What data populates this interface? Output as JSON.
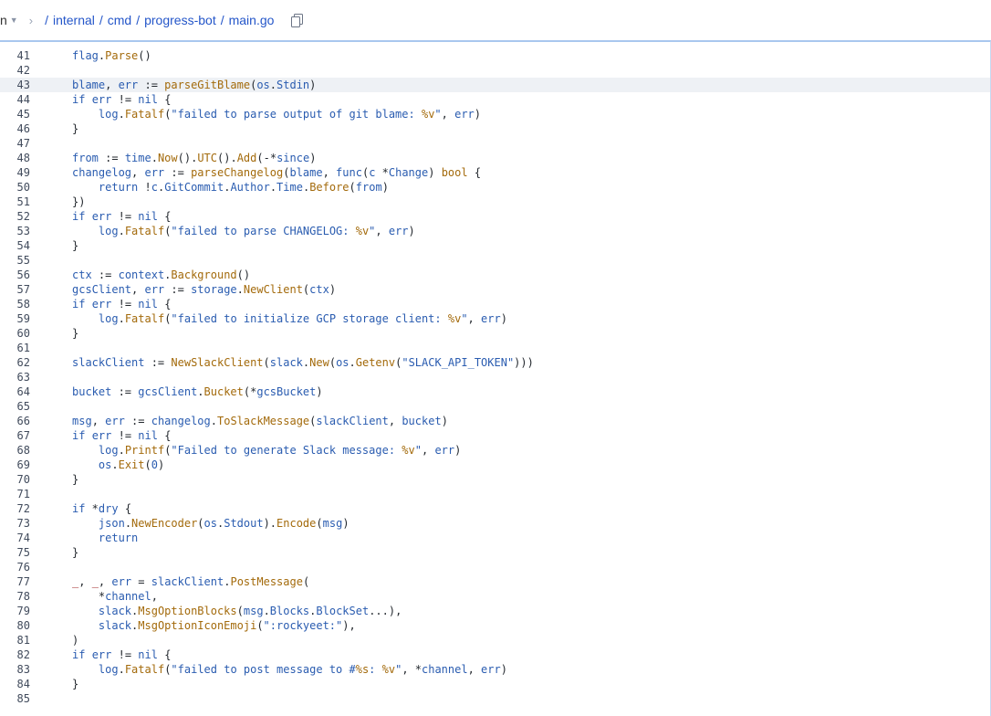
{
  "breadcrumb": {
    "branch": "n",
    "segments": [
      "internal",
      "cmd",
      "progress-bot",
      "main.go"
    ]
  },
  "editor": {
    "highlighted_line": 43,
    "lines": [
      {
        "n": 41,
        "indent": 1,
        "tokens": [
          [
            "ident",
            "flag"
          ],
          [
            "op",
            "."
          ],
          [
            "fn",
            "Parse"
          ],
          [
            "op",
            "()"
          ]
        ]
      },
      {
        "n": 42,
        "indent": 0,
        "tokens": []
      },
      {
        "n": 43,
        "indent": 1,
        "tokens": [
          [
            "ident",
            "blame"
          ],
          [
            "op",
            ", "
          ],
          [
            "ident",
            "err"
          ],
          [
            "op",
            " := "
          ],
          [
            "fn",
            "parseGitBlame"
          ],
          [
            "op",
            "("
          ],
          [
            "ident",
            "os"
          ],
          [
            "op",
            "."
          ],
          [
            "ident",
            "Stdin"
          ],
          [
            "op",
            ")"
          ]
        ]
      },
      {
        "n": 44,
        "indent": 1,
        "tokens": [
          [
            "kw",
            "if"
          ],
          [
            "op",
            " "
          ],
          [
            "ident",
            "err"
          ],
          [
            "op",
            " != "
          ],
          [
            "kw",
            "nil"
          ],
          [
            "op",
            " {"
          ]
        ]
      },
      {
        "n": 45,
        "indent": 2,
        "tokens": [
          [
            "ident",
            "log"
          ],
          [
            "op",
            "."
          ],
          [
            "fn",
            "Fatalf"
          ],
          [
            "op",
            "("
          ],
          [
            "str",
            "\"failed to parse output of git blame: "
          ],
          [
            "fmt",
            "%v"
          ],
          [
            "str",
            "\""
          ],
          [
            "op",
            ", "
          ],
          [
            "ident",
            "err"
          ],
          [
            "op",
            ")"
          ]
        ]
      },
      {
        "n": 46,
        "indent": 1,
        "tokens": [
          [
            "op",
            "}"
          ]
        ]
      },
      {
        "n": 47,
        "indent": 0,
        "tokens": []
      },
      {
        "n": 48,
        "indent": 1,
        "tokens": [
          [
            "ident",
            "from"
          ],
          [
            "op",
            " := "
          ],
          [
            "ident",
            "time"
          ],
          [
            "op",
            "."
          ],
          [
            "fn",
            "Now"
          ],
          [
            "op",
            "()."
          ],
          [
            "fn",
            "UTC"
          ],
          [
            "op",
            "()."
          ],
          [
            "fn",
            "Add"
          ],
          [
            "op",
            "(-*"
          ],
          [
            "ident",
            "since"
          ],
          [
            "op",
            ")"
          ]
        ]
      },
      {
        "n": 49,
        "indent": 1,
        "tokens": [
          [
            "ident",
            "changelog"
          ],
          [
            "op",
            ", "
          ],
          [
            "ident",
            "err"
          ],
          [
            "op",
            " := "
          ],
          [
            "fn",
            "parseChangelog"
          ],
          [
            "op",
            "("
          ],
          [
            "ident",
            "blame"
          ],
          [
            "op",
            ", "
          ],
          [
            "kw",
            "func"
          ],
          [
            "op",
            "("
          ],
          [
            "ident",
            "c"
          ],
          [
            "op",
            " *"
          ],
          [
            "ident",
            "Change"
          ],
          [
            "op",
            ") "
          ],
          [
            "fn",
            "bool"
          ],
          [
            "op",
            " {"
          ]
        ]
      },
      {
        "n": 50,
        "indent": 2,
        "tokens": [
          [
            "kw",
            "return"
          ],
          [
            "op",
            " !"
          ],
          [
            "ident",
            "c"
          ],
          [
            "op",
            "."
          ],
          [
            "ident",
            "GitCommit"
          ],
          [
            "op",
            "."
          ],
          [
            "ident",
            "Author"
          ],
          [
            "op",
            "."
          ],
          [
            "ident",
            "Time"
          ],
          [
            "op",
            "."
          ],
          [
            "fn",
            "Before"
          ],
          [
            "op",
            "("
          ],
          [
            "ident",
            "from"
          ],
          [
            "op",
            ")"
          ]
        ]
      },
      {
        "n": 51,
        "indent": 1,
        "tokens": [
          [
            "op",
            "})"
          ]
        ]
      },
      {
        "n": 52,
        "indent": 1,
        "tokens": [
          [
            "kw",
            "if"
          ],
          [
            "op",
            " "
          ],
          [
            "ident",
            "err"
          ],
          [
            "op",
            " != "
          ],
          [
            "kw",
            "nil"
          ],
          [
            "op",
            " {"
          ]
        ]
      },
      {
        "n": 53,
        "indent": 2,
        "tokens": [
          [
            "ident",
            "log"
          ],
          [
            "op",
            "."
          ],
          [
            "fn",
            "Fatalf"
          ],
          [
            "op",
            "("
          ],
          [
            "str",
            "\"failed to parse CHANGELOG: "
          ],
          [
            "fmt",
            "%v"
          ],
          [
            "str",
            "\""
          ],
          [
            "op",
            ", "
          ],
          [
            "ident",
            "err"
          ],
          [
            "op",
            ")"
          ]
        ]
      },
      {
        "n": 54,
        "indent": 1,
        "tokens": [
          [
            "op",
            "}"
          ]
        ]
      },
      {
        "n": 55,
        "indent": 0,
        "tokens": []
      },
      {
        "n": 56,
        "indent": 1,
        "tokens": [
          [
            "ident",
            "ctx"
          ],
          [
            "op",
            " := "
          ],
          [
            "ident",
            "context"
          ],
          [
            "op",
            "."
          ],
          [
            "fn",
            "Background"
          ],
          [
            "op",
            "()"
          ]
        ]
      },
      {
        "n": 57,
        "indent": 1,
        "tokens": [
          [
            "ident",
            "gcsClient"
          ],
          [
            "op",
            ", "
          ],
          [
            "ident",
            "err"
          ],
          [
            "op",
            " := "
          ],
          [
            "ident",
            "storage"
          ],
          [
            "op",
            "."
          ],
          [
            "fn",
            "NewClient"
          ],
          [
            "op",
            "("
          ],
          [
            "ident",
            "ctx"
          ],
          [
            "op",
            ")"
          ]
        ]
      },
      {
        "n": 58,
        "indent": 1,
        "tokens": [
          [
            "kw",
            "if"
          ],
          [
            "op",
            " "
          ],
          [
            "ident",
            "err"
          ],
          [
            "op",
            " != "
          ],
          [
            "kw",
            "nil"
          ],
          [
            "op",
            " {"
          ]
        ]
      },
      {
        "n": 59,
        "indent": 2,
        "tokens": [
          [
            "ident",
            "log"
          ],
          [
            "op",
            "."
          ],
          [
            "fn",
            "Fatalf"
          ],
          [
            "op",
            "("
          ],
          [
            "str",
            "\"failed to initialize GCP storage client: "
          ],
          [
            "fmt",
            "%v"
          ],
          [
            "str",
            "\""
          ],
          [
            "op",
            ", "
          ],
          [
            "ident",
            "err"
          ],
          [
            "op",
            ")"
          ]
        ]
      },
      {
        "n": 60,
        "indent": 1,
        "tokens": [
          [
            "op",
            "}"
          ]
        ]
      },
      {
        "n": 61,
        "indent": 0,
        "tokens": []
      },
      {
        "n": 62,
        "indent": 1,
        "tokens": [
          [
            "ident",
            "slackClient"
          ],
          [
            "op",
            " := "
          ],
          [
            "fn",
            "NewSlackClient"
          ],
          [
            "op",
            "("
          ],
          [
            "ident",
            "slack"
          ],
          [
            "op",
            "."
          ],
          [
            "fn",
            "New"
          ],
          [
            "op",
            "("
          ],
          [
            "ident",
            "os"
          ],
          [
            "op",
            "."
          ],
          [
            "fn",
            "Getenv"
          ],
          [
            "op",
            "("
          ],
          [
            "str",
            "\"SLACK_API_TOKEN\""
          ],
          [
            "op",
            "))"
          ],
          [
            "op",
            ")"
          ]
        ]
      },
      {
        "n": 63,
        "indent": 0,
        "tokens": []
      },
      {
        "n": 64,
        "indent": 1,
        "tokens": [
          [
            "ident",
            "bucket"
          ],
          [
            "op",
            " := "
          ],
          [
            "ident",
            "gcsClient"
          ],
          [
            "op",
            "."
          ],
          [
            "fn",
            "Bucket"
          ],
          [
            "op",
            "(*"
          ],
          [
            "ident",
            "gcsBucket"
          ],
          [
            "op",
            ")"
          ]
        ]
      },
      {
        "n": 65,
        "indent": 0,
        "tokens": []
      },
      {
        "n": 66,
        "indent": 1,
        "tokens": [
          [
            "ident",
            "msg"
          ],
          [
            "op",
            ", "
          ],
          [
            "ident",
            "err"
          ],
          [
            "op",
            " := "
          ],
          [
            "ident",
            "changelog"
          ],
          [
            "op",
            "."
          ],
          [
            "fn",
            "ToSlackMessage"
          ],
          [
            "op",
            "("
          ],
          [
            "ident",
            "slackClient"
          ],
          [
            "op",
            ", "
          ],
          [
            "ident",
            "bucket"
          ],
          [
            "op",
            ")"
          ]
        ]
      },
      {
        "n": 67,
        "indent": 1,
        "tokens": [
          [
            "kw",
            "if"
          ],
          [
            "op",
            " "
          ],
          [
            "ident",
            "err"
          ],
          [
            "op",
            " != "
          ],
          [
            "kw",
            "nil"
          ],
          [
            "op",
            " {"
          ]
        ]
      },
      {
        "n": 68,
        "indent": 2,
        "tokens": [
          [
            "ident",
            "log"
          ],
          [
            "op",
            "."
          ],
          [
            "fn",
            "Printf"
          ],
          [
            "op",
            "("
          ],
          [
            "str",
            "\"Failed to generate Slack message: "
          ],
          [
            "fmt",
            "%v"
          ],
          [
            "str",
            "\""
          ],
          [
            "op",
            ", "
          ],
          [
            "ident",
            "err"
          ],
          [
            "op",
            ")"
          ]
        ]
      },
      {
        "n": 69,
        "indent": 2,
        "tokens": [
          [
            "ident",
            "os"
          ],
          [
            "op",
            "."
          ],
          [
            "fn",
            "Exit"
          ],
          [
            "op",
            "("
          ],
          [
            "ident",
            "0"
          ],
          [
            "op",
            ")"
          ]
        ]
      },
      {
        "n": 70,
        "indent": 1,
        "tokens": [
          [
            "op",
            "}"
          ]
        ]
      },
      {
        "n": 71,
        "indent": 0,
        "tokens": []
      },
      {
        "n": 72,
        "indent": 1,
        "tokens": [
          [
            "kw",
            "if"
          ],
          [
            "op",
            " *"
          ],
          [
            "ident",
            "dry"
          ],
          [
            "op",
            " {"
          ]
        ]
      },
      {
        "n": 73,
        "indent": 2,
        "tokens": [
          [
            "ident",
            "json"
          ],
          [
            "op",
            "."
          ],
          [
            "fn",
            "NewEncoder"
          ],
          [
            "op",
            "("
          ],
          [
            "ident",
            "os"
          ],
          [
            "op",
            "."
          ],
          [
            "ident",
            "Stdout"
          ],
          [
            "op",
            ")."
          ],
          [
            "fn",
            "Encode"
          ],
          [
            "op",
            "("
          ],
          [
            "ident",
            "msg"
          ],
          [
            "op",
            ")"
          ]
        ]
      },
      {
        "n": 74,
        "indent": 2,
        "tokens": [
          [
            "kw",
            "return"
          ]
        ]
      },
      {
        "n": 75,
        "indent": 1,
        "tokens": [
          [
            "op",
            "}"
          ]
        ]
      },
      {
        "n": 76,
        "indent": 0,
        "tokens": []
      },
      {
        "n": 77,
        "indent": 1,
        "tokens": [
          [
            "blank",
            "_"
          ],
          [
            "op",
            ", "
          ],
          [
            "blank",
            "_"
          ],
          [
            "op",
            ", "
          ],
          [
            "ident",
            "err"
          ],
          [
            "op",
            " = "
          ],
          [
            "ident",
            "slackClient"
          ],
          [
            "op",
            "."
          ],
          [
            "fn",
            "PostMessage"
          ],
          [
            "op",
            "("
          ]
        ]
      },
      {
        "n": 78,
        "indent": 2,
        "tokens": [
          [
            "op",
            "*"
          ],
          [
            "ident",
            "channel"
          ],
          [
            "op",
            ","
          ]
        ]
      },
      {
        "n": 79,
        "indent": 2,
        "tokens": [
          [
            "ident",
            "slack"
          ],
          [
            "op",
            "."
          ],
          [
            "fn",
            "MsgOptionBlocks"
          ],
          [
            "op",
            "("
          ],
          [
            "ident",
            "msg"
          ],
          [
            "op",
            "."
          ],
          [
            "ident",
            "Blocks"
          ],
          [
            "op",
            "."
          ],
          [
            "ident",
            "BlockSet"
          ],
          [
            "op",
            "...),"
          ]
        ]
      },
      {
        "n": 80,
        "indent": 2,
        "tokens": [
          [
            "ident",
            "slack"
          ],
          [
            "op",
            "."
          ],
          [
            "fn",
            "MsgOptionIconEmoji"
          ],
          [
            "op",
            "("
          ],
          [
            "str",
            "\":rockyeet:\""
          ],
          [
            "op",
            "),"
          ]
        ]
      },
      {
        "n": 81,
        "indent": 1,
        "tokens": [
          [
            "op",
            ")"
          ]
        ]
      },
      {
        "n": 82,
        "indent": 1,
        "tokens": [
          [
            "kw",
            "if"
          ],
          [
            "op",
            " "
          ],
          [
            "ident",
            "err"
          ],
          [
            "op",
            " != "
          ],
          [
            "kw",
            "nil"
          ],
          [
            "op",
            " {"
          ]
        ]
      },
      {
        "n": 83,
        "indent": 2,
        "tokens": [
          [
            "ident",
            "log"
          ],
          [
            "op",
            "."
          ],
          [
            "fn",
            "Fatalf"
          ],
          [
            "op",
            "("
          ],
          [
            "str",
            "\"failed to post message to #"
          ],
          [
            "fmt",
            "%s"
          ],
          [
            "str",
            ": "
          ],
          [
            "fmt",
            "%v"
          ],
          [
            "str",
            "\""
          ],
          [
            "op",
            ", *"
          ],
          [
            "ident",
            "channel"
          ],
          [
            "op",
            ", "
          ],
          [
            "ident",
            "err"
          ],
          [
            "op",
            ")"
          ]
        ]
      },
      {
        "n": 84,
        "indent": 1,
        "tokens": [
          [
            "op",
            "}"
          ]
        ]
      },
      {
        "n": 85,
        "indent": 0,
        "tokens": []
      }
    ]
  }
}
